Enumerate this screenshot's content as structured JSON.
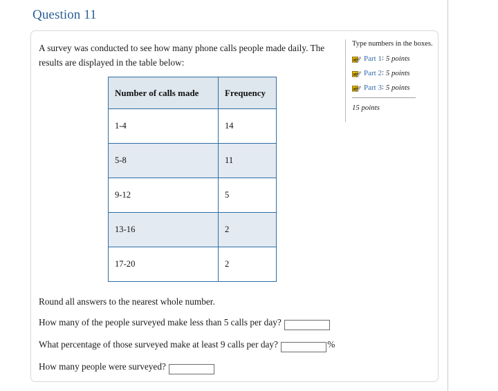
{
  "page": {
    "title": "Question 11",
    "title_color": "#2b5f97"
  },
  "question": {
    "intro": "A survey was conducted to see how many phone calls people made daily. The results are displayed in the table below:",
    "rounding_note": "Round all answers to the nearest whole number."
  },
  "chart_data": {
    "type": "table",
    "title": "",
    "columns": [
      "Number of calls made",
      "Frequency"
    ],
    "categories": [
      "1-4",
      "5-8",
      "9-12",
      "13-16",
      "17-20"
    ],
    "values": [
      14,
      11,
      5,
      2,
      2
    ],
    "rows": [
      {
        "label": "1-4",
        "frequency": "14"
      },
      {
        "label": "5-8",
        "frequency": "11"
      },
      {
        "label": "9-12",
        "frequency": "5"
      },
      {
        "label": "13-16",
        "frequency": "2"
      },
      {
        "label": "17-20",
        "frequency": "2"
      }
    ],
    "xlabel": "Number of calls made",
    "ylabel": "Frequency",
    "border_color": "#2d6ca2",
    "header_bg": "#dee6ee",
    "row_tint_bg": "#e3eaf2"
  },
  "sub_questions": [
    {
      "prompt": "How many of the people surveyed make less than 5 calls per day?",
      "value": "",
      "placeholder": "",
      "suffix": ""
    },
    {
      "prompt": "What percentage of those surveyed make at least 9 calls per day?",
      "value": "",
      "placeholder": "",
      "suffix": "%"
    },
    {
      "prompt": "How many people were surveyed?",
      "value": "",
      "placeholder": "",
      "suffix": ""
    }
  ],
  "sidebar": {
    "instruction": "Type numbers in the boxes.",
    "parts": [
      {
        "icon": "text-entry-icon",
        "label": "Part 1",
        "colon": ":",
        "points": "5 points"
      },
      {
        "icon": "text-entry-icon",
        "label": "Part 2",
        "colon": ":",
        "points": "5 points"
      },
      {
        "icon": "text-entry-icon",
        "label": "Part 3",
        "colon": ":",
        "points": "5 points"
      }
    ],
    "total_points": "15 points",
    "link_color": "#2f6aa8"
  }
}
